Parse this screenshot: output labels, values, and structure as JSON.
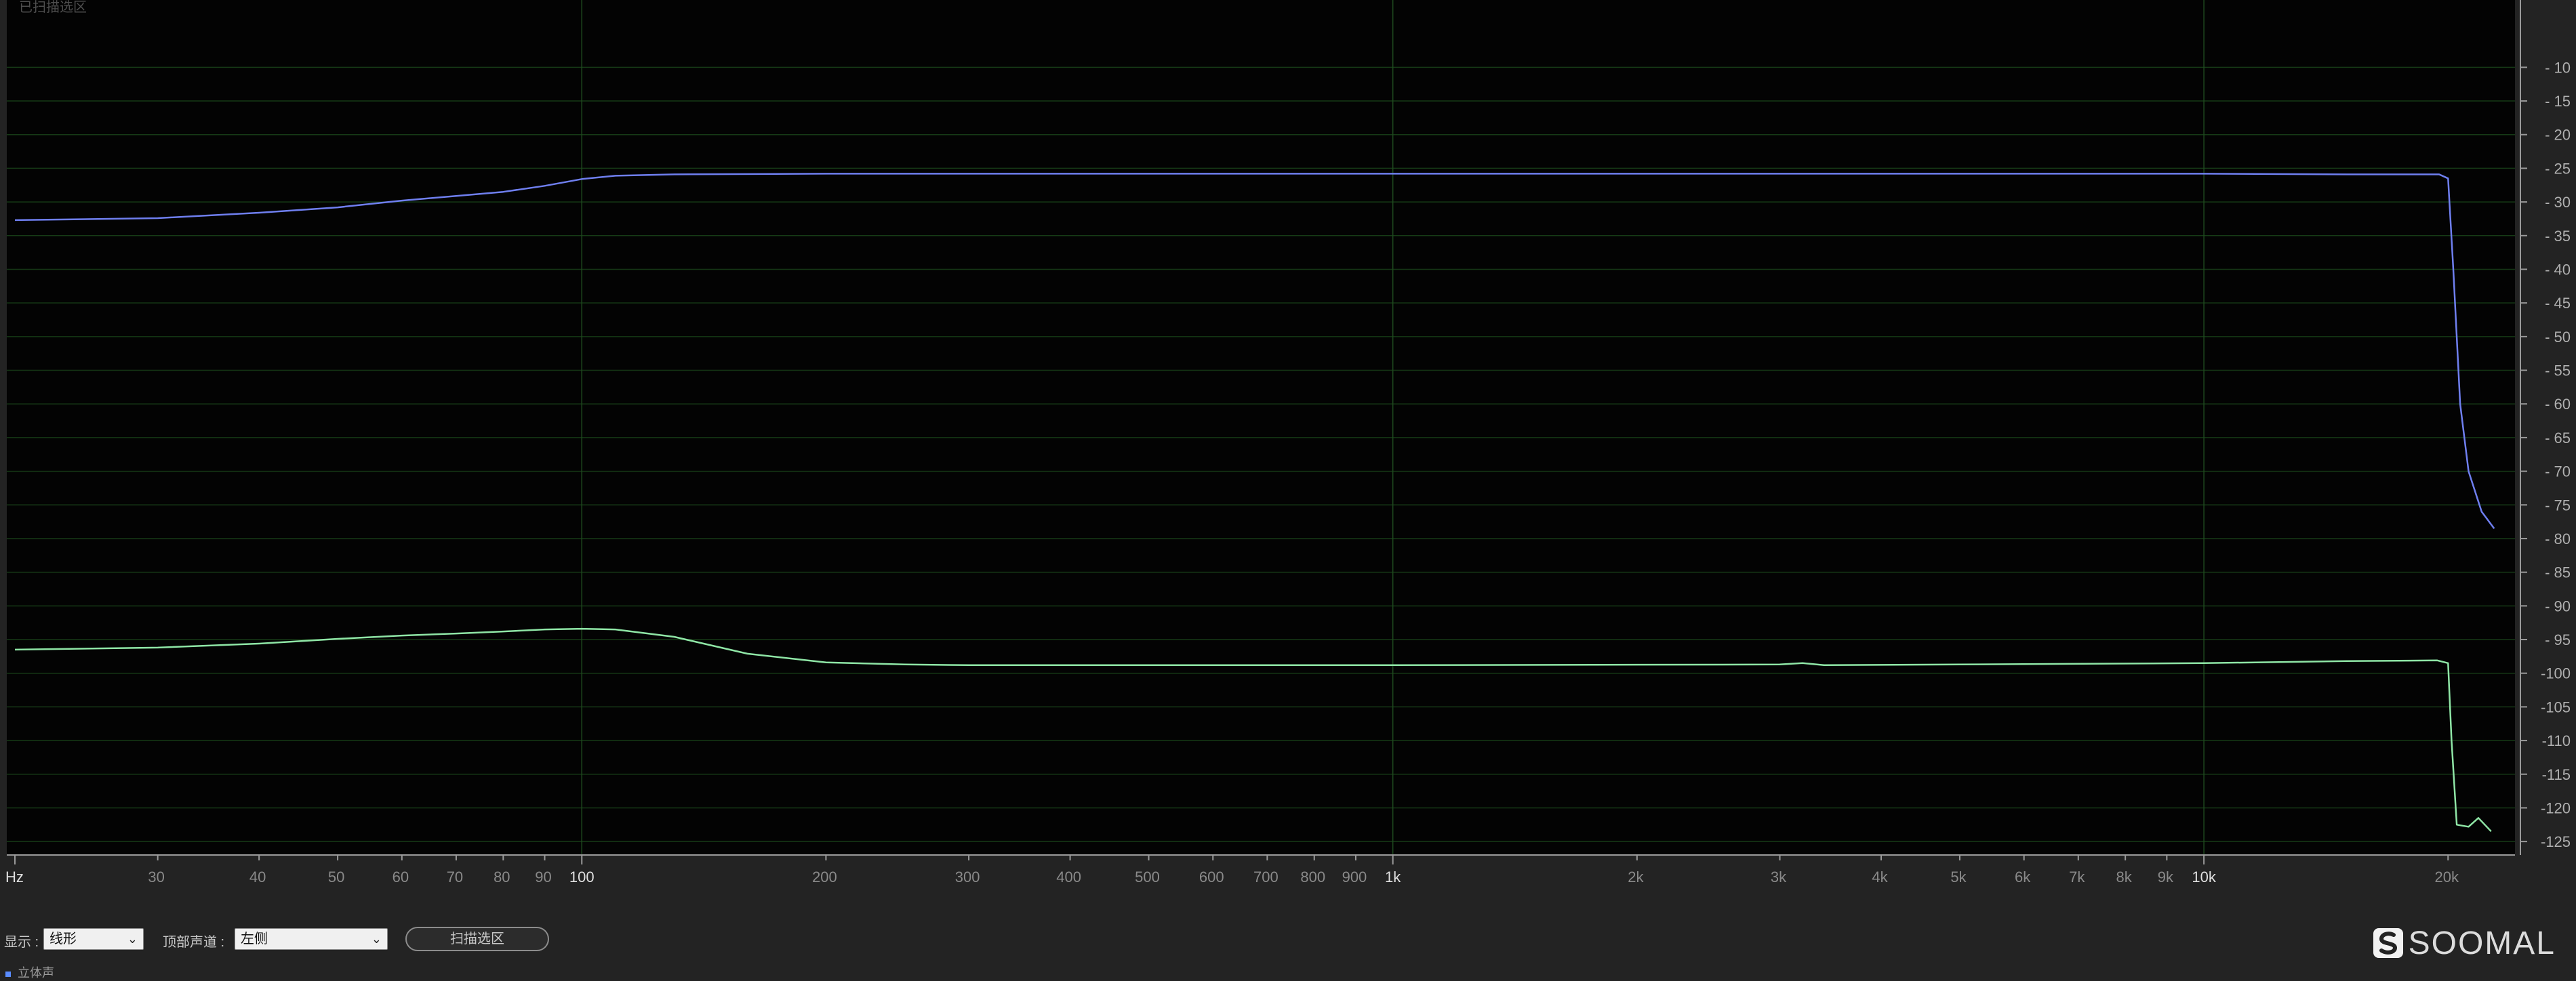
{
  "chart_data": {
    "type": "line",
    "overlay_title": "已扫描选区",
    "x_scale": "log",
    "xlim": [
      20,
      24000
    ],
    "ylim": [
      -127,
      0
    ],
    "grid": true,
    "x_ticks": [
      {
        "value": 20,
        "label": "Hz",
        "major": true
      },
      {
        "value": 30,
        "label": "30",
        "major": false
      },
      {
        "value": 40,
        "label": "40",
        "major": false
      },
      {
        "value": 50,
        "label": "50",
        "major": false
      },
      {
        "value": 60,
        "label": "60",
        "major": false
      },
      {
        "value": 70,
        "label": "70",
        "major": false
      },
      {
        "value": 80,
        "label": "80",
        "major": false
      },
      {
        "value": 90,
        "label": "90",
        "major": false
      },
      {
        "value": 100,
        "label": "100",
        "major": true
      },
      {
        "value": 200,
        "label": "200",
        "major": false
      },
      {
        "value": 300,
        "label": "300",
        "major": false
      },
      {
        "value": 400,
        "label": "400",
        "major": false
      },
      {
        "value": 500,
        "label": "500",
        "major": false
      },
      {
        "value": 600,
        "label": "600",
        "major": false
      },
      {
        "value": 700,
        "label": "700",
        "major": false
      },
      {
        "value": 800,
        "label": "800",
        "major": false
      },
      {
        "value": 900,
        "label": "900",
        "major": false
      },
      {
        "value": 1000,
        "label": "1k",
        "major": true
      },
      {
        "value": 2000,
        "label": "2k",
        "major": false
      },
      {
        "value": 3000,
        "label": "3k",
        "major": false
      },
      {
        "value": 4000,
        "label": "4k",
        "major": false
      },
      {
        "value": 5000,
        "label": "5k",
        "major": false
      },
      {
        "value": 6000,
        "label": "6k",
        "major": false
      },
      {
        "value": 7000,
        "label": "7k",
        "major": false
      },
      {
        "value": 8000,
        "label": "8k",
        "major": false
      },
      {
        "value": 9000,
        "label": "9k",
        "major": false
      },
      {
        "value": 10000,
        "label": "10k",
        "major": true
      },
      {
        "value": 20000,
        "label": "20k",
        "major": false
      }
    ],
    "y_ticks": [
      {
        "value": -10,
        "label": "- 10"
      },
      {
        "value": -15,
        "label": "- 15"
      },
      {
        "value": -20,
        "label": "- 20"
      },
      {
        "value": -25,
        "label": "- 25"
      },
      {
        "value": -30,
        "label": "- 30"
      },
      {
        "value": -35,
        "label": "- 35"
      },
      {
        "value": -40,
        "label": "- 40"
      },
      {
        "value": -45,
        "label": "- 45"
      },
      {
        "value": -50,
        "label": "- 50"
      },
      {
        "value": -55,
        "label": "- 55"
      },
      {
        "value": -60,
        "label": "- 60"
      },
      {
        "value": -65,
        "label": "- 65"
      },
      {
        "value": -70,
        "label": "- 70"
      },
      {
        "value": -75,
        "label": "- 75"
      },
      {
        "value": -80,
        "label": "- 80"
      },
      {
        "value": -85,
        "label": "- 85"
      },
      {
        "value": -90,
        "label": "- 90"
      },
      {
        "value": -95,
        "label": "- 95"
      },
      {
        "value": -100,
        "label": "-100"
      },
      {
        "value": -105,
        "label": "-105"
      },
      {
        "value": -110,
        "label": "-110"
      },
      {
        "value": -115,
        "label": "-115"
      },
      {
        "value": -120,
        "label": "-120"
      },
      {
        "value": -125,
        "label": "-125"
      }
    ],
    "series": [
      {
        "color": "#6f7ff0",
        "points": [
          [
            20,
            -32.7
          ],
          [
            30,
            -32.4
          ],
          [
            40,
            -31.6
          ],
          [
            50,
            -30.8
          ],
          [
            60,
            -29.8
          ],
          [
            70,
            -29.1
          ],
          [
            80,
            -28.5
          ],
          [
            90,
            -27.6
          ],
          [
            100,
            -26.6
          ],
          [
            110,
            -26.1
          ],
          [
            130,
            -25.9
          ],
          [
            200,
            -25.8
          ],
          [
            1000,
            -25.8
          ],
          [
            5000,
            -25.8
          ],
          [
            10000,
            -25.8
          ],
          [
            15000,
            -25.9
          ],
          [
            19500,
            -25.9
          ],
          [
            20000,
            -26.5
          ],
          [
            20300,
            -40
          ],
          [
            20700,
            -60
          ],
          [
            21200,
            -70
          ],
          [
            22000,
            -76
          ],
          [
            22800,
            -78.5
          ]
        ]
      },
      {
        "color": "#8fe6a6",
        "points": [
          [
            20,
            -96.5
          ],
          [
            30,
            -96.2
          ],
          [
            40,
            -95.6
          ],
          [
            50,
            -94.9
          ],
          [
            60,
            -94.4
          ],
          [
            70,
            -94.1
          ],
          [
            80,
            -93.8
          ],
          [
            90,
            -93.5
          ],
          [
            100,
            -93.4
          ],
          [
            110,
            -93.5
          ],
          [
            130,
            -94.6
          ],
          [
            160,
            -97.1
          ],
          [
            200,
            -98.4
          ],
          [
            250,
            -98.7
          ],
          [
            300,
            -98.8
          ],
          [
            1000,
            -98.8
          ],
          [
            3000,
            -98.7
          ],
          [
            3200,
            -98.5
          ],
          [
            3400,
            -98.8
          ],
          [
            5000,
            -98.7
          ],
          [
            10000,
            -98.5
          ],
          [
            15000,
            -98.2
          ],
          [
            19400,
            -98.1
          ],
          [
            20000,
            -98.5
          ],
          [
            20200,
            -110
          ],
          [
            20500,
            -122.5
          ],
          [
            21200,
            -122.8
          ],
          [
            21800,
            -121.5
          ],
          [
            22600,
            -123.5
          ]
        ]
      }
    ]
  },
  "controls": {
    "display_label": "显示 :",
    "display_value": "线形",
    "channel_label": "顶部声道 :",
    "channel_value": "左侧",
    "scan_button": "扫描选区"
  },
  "bottom_tag": "立体声",
  "logo": {
    "text": "SOOMAL"
  }
}
